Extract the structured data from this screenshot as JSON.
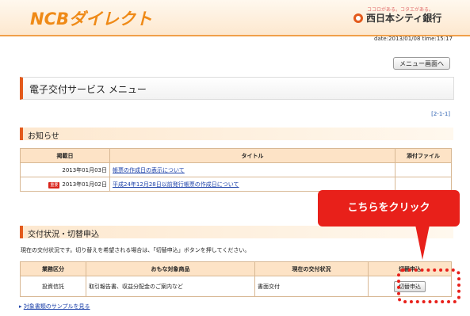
{
  "header": {
    "logo": "NCBダイレクト",
    "bank_tagline": "ココロがある。コタエがある。",
    "bank_name": "西日本シティ銀行",
    "datetime": "date:2013/01/08 time:15:17"
  },
  "menu_button": "メニュー画面へ",
  "page_title": "電子交付サービス メニュー",
  "page_ref": "[2-1-1]",
  "notice": {
    "heading": "お知らせ",
    "columns": [
      "掲載日",
      "タイトル",
      "添付ファイル"
    ],
    "rows": [
      {
        "badge": "",
        "date": "2013年01月03日",
        "title": "帳票の作成日の表示について",
        "attachment": ""
      },
      {
        "badge": "重要",
        "date": "2013年01月02日",
        "title": "平成24年12月28日以前発行帳票の作成日について",
        "attachment": ""
      }
    ]
  },
  "delivery": {
    "heading": "交付状況・切替申込",
    "info": "現在の交付状況です。切り替えを希望される場合は、「切替申込」ボタンを押してください。",
    "columns": [
      "業務区分",
      "おもな対象商品",
      "現在の交付状況",
      "切替申込"
    ],
    "rows": [
      {
        "category": "投資信託",
        "products": "取引報告書、収益分配金のご案内など",
        "status": "書面交付",
        "button": "切替申込"
      }
    ],
    "sample_link": "対象書類のサンプルを見る"
  },
  "callout": "こちらをクリック",
  "colors": {
    "accent": "#ef8a17",
    "callout": "#e8201a",
    "header_fill": "#fde3c6"
  }
}
